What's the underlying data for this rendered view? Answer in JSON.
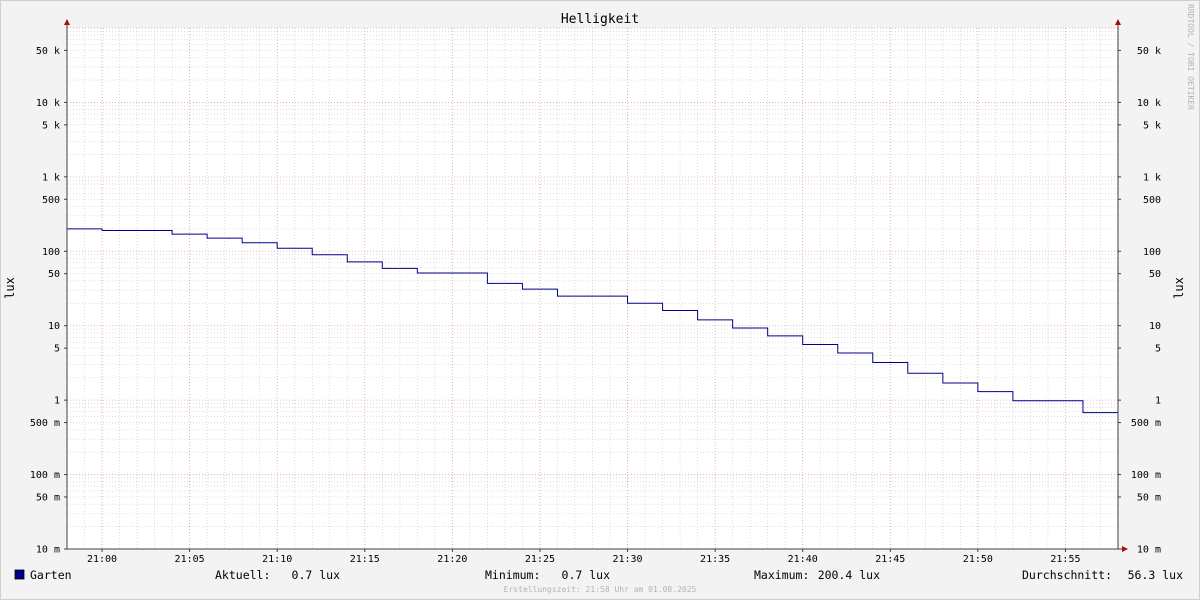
{
  "chart_data": {
    "type": "line",
    "title": "Helligkeit",
    "ylabel": "lux",
    "yscale": "log",
    "ylim": [
      0.01,
      100000
    ],
    "y_ticks": [
      {
        "value": 50000,
        "label": "50 k"
      },
      {
        "value": 10000,
        "label": "10 k"
      },
      {
        "value": 5000,
        "label": "5 k"
      },
      {
        "value": 1000,
        "label": "1 k"
      },
      {
        "value": 500,
        "label": "500"
      },
      {
        "value": 100,
        "label": "100"
      },
      {
        "value": 50,
        "label": "50"
      },
      {
        "value": 10,
        "label": "10"
      },
      {
        "value": 5,
        "label": "5"
      },
      {
        "value": 1,
        "label": "1"
      },
      {
        "value": 0.5,
        "label": "500 m"
      },
      {
        "value": 0.1,
        "label": "100 m"
      },
      {
        "value": 0.05,
        "label": "50 m"
      },
      {
        "value": 0.01,
        "label": "10 m"
      }
    ],
    "xlim": [
      "20:58",
      "21:58"
    ],
    "x_ticks": [
      "21:00",
      "21:05",
      "21:10",
      "21:15",
      "21:20",
      "21:25",
      "21:30",
      "21:35",
      "21:40",
      "21:45",
      "21:50",
      "21:55"
    ],
    "grid": true,
    "series": [
      {
        "name": "Garten",
        "color": "#00008b",
        "points": [
          {
            "x": "20:58",
            "y": 200
          },
          {
            "x": "21:00",
            "y": 190
          },
          {
            "x": "21:04",
            "y": 170
          },
          {
            "x": "21:06",
            "y": 150
          },
          {
            "x": "21:08",
            "y": 130
          },
          {
            "x": "21:10",
            "y": 110
          },
          {
            "x": "21:12",
            "y": 90
          },
          {
            "x": "21:14",
            "y": 72
          },
          {
            "x": "21:16",
            "y": 59
          },
          {
            "x": "21:18",
            "y": 51
          },
          {
            "x": "21:22",
            "y": 37
          },
          {
            "x": "21:24",
            "y": 31
          },
          {
            "x": "21:26",
            "y": 25
          },
          {
            "x": "21:30",
            "y": 20
          },
          {
            "x": "21:32",
            "y": 16
          },
          {
            "x": "21:34",
            "y": 12
          },
          {
            "x": "21:36",
            "y": 9.3
          },
          {
            "x": "21:38",
            "y": 7.3
          },
          {
            "x": "21:40",
            "y": 5.6
          },
          {
            "x": "21:42",
            "y": 4.3
          },
          {
            "x": "21:44",
            "y": 3.2
          },
          {
            "x": "21:46",
            "y": 2.3
          },
          {
            "x": "21:48",
            "y": 1.7
          },
          {
            "x": "21:50",
            "y": 1.3
          },
          {
            "x": "21:52",
            "y": 0.98
          },
          {
            "x": "21:56",
            "y": 0.68
          },
          {
            "x": "21:58",
            "y": 0.68
          }
        ]
      }
    ]
  },
  "legend": {
    "series_name": "Garten",
    "current": {
      "label": "Aktuell:",
      "value": "0.7 lux"
    },
    "minimum": {
      "label": "Minimum:",
      "value": "0.7 lux"
    },
    "maximum": {
      "label": "Maximum:",
      "value": "200.4 lux"
    },
    "average": {
      "label": "Durchschnitt:",
      "value": "56.3 lux"
    }
  },
  "footer": "Erstellungszeit: 21:58 Uhr am 01.08.2025",
  "watermark": "RRDTOOL / TOBI OETIKER",
  "colors": {
    "series": "#00008b",
    "major_grid": "#e8a0a8",
    "minor_grid": "#c8c8c8",
    "axis": "#404040",
    "arrow": "#a01010"
  }
}
